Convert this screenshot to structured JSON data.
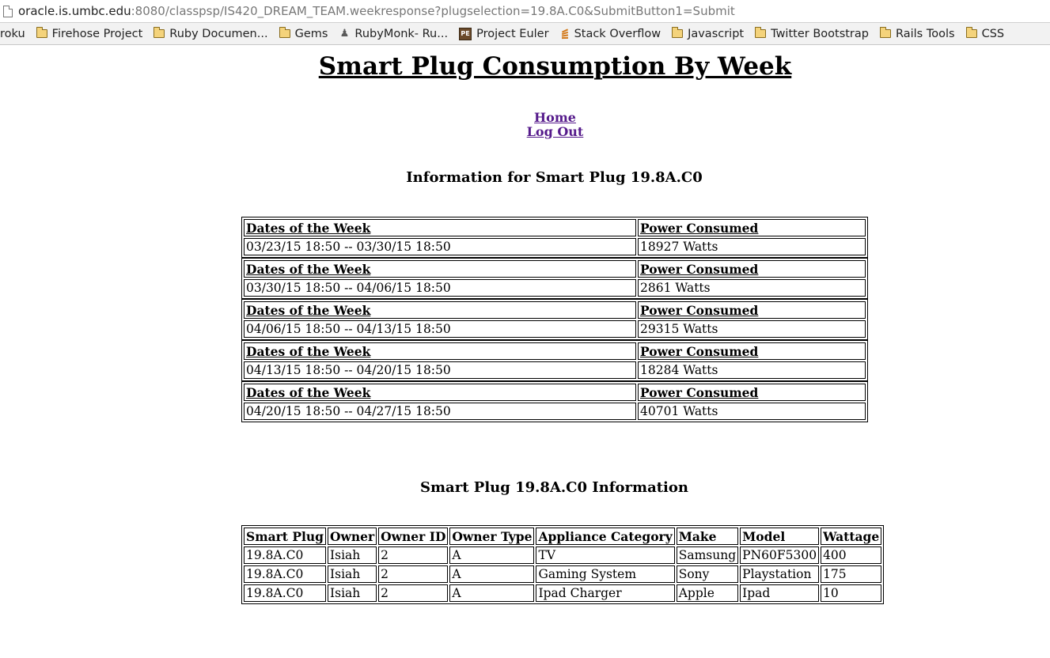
{
  "browser": {
    "url_host": "oracle.is.umbc.edu",
    "url_rest": ":8080/classpsp/IS420_DREAM_TEAM.weekresponse?plugselection=19.8A.C0&SubmitButton1=Submit",
    "bookmarks": [
      {
        "label": "roku",
        "icon": "none"
      },
      {
        "label": "Firehose Project",
        "icon": "folder-icon"
      },
      {
        "label": "Ruby Documen...",
        "icon": "folder-icon"
      },
      {
        "label": "Gems",
        "icon": "folder-icon"
      },
      {
        "label": "RubyMonk- Ru...",
        "icon": "rubymonk-icon"
      },
      {
        "label": "Project Euler",
        "icon": "project-euler-icon"
      },
      {
        "label": "Stack Overflow",
        "icon": "stack-overflow-icon"
      },
      {
        "label": "Javascript",
        "icon": "folder-icon"
      },
      {
        "label": "Twitter Bootstrap",
        "icon": "folder-icon"
      },
      {
        "label": "Rails Tools",
        "icon": "folder-icon"
      },
      {
        "label": "CSS",
        "icon": "folder-icon"
      }
    ]
  },
  "page": {
    "title": "Smart Plug Consumption By Week",
    "nav": {
      "home": "Home",
      "logout": "Log Out"
    },
    "weekly_heading": "Information for Smart Plug 19.8A.C0",
    "weekly_col_dates": "Dates of the Week",
    "weekly_col_power": "Power Consumed",
    "weeks": [
      {
        "dates": "03/23/15 18:50 -- 03/30/15 18:50",
        "power": "18927 Watts"
      },
      {
        "dates": "03/30/15 18:50 -- 04/06/15 18:50",
        "power": "2861 Watts"
      },
      {
        "dates": "04/06/15 18:50 -- 04/13/15 18:50",
        "power": "29315 Watts"
      },
      {
        "dates": "04/13/15 18:50 -- 04/20/15 18:50",
        "power": "18284 Watts"
      },
      {
        "dates": "04/20/15 18:50 -- 04/27/15 18:50",
        "power": "40701 Watts"
      }
    ],
    "info_heading": "Smart Plug 19.8A.C0 Information",
    "info_columns": [
      "Smart Plug",
      "Owner",
      "Owner ID",
      "Owner Type",
      "Appliance Category",
      "Make",
      "Model",
      "Wattage"
    ],
    "info_rows": [
      [
        "19.8A.C0",
        "Isiah",
        "2",
        "A",
        "TV",
        "Samsung",
        "PN60F5300",
        "400"
      ],
      [
        "19.8A.C0",
        "Isiah",
        "2",
        "A",
        "Gaming System",
        "Sony",
        "Playstation",
        "175"
      ],
      [
        "19.8A.C0",
        "Isiah",
        "2",
        "A",
        "Ipad Charger",
        "Apple",
        "Ipad",
        "10"
      ]
    ]
  },
  "colors": {
    "link_visited": "#551a8b",
    "folder": "#f4d37b"
  }
}
